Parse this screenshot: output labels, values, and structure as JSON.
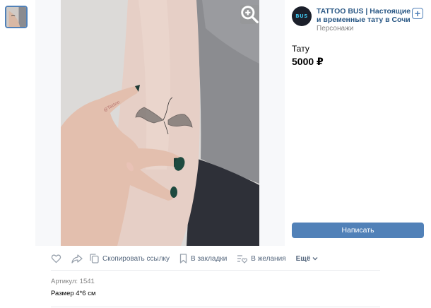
{
  "owner": {
    "name": "TATTOO BUS | Настоящие и временные тату в Сочи",
    "category": "Персонажи",
    "avatar_text": "BUS"
  },
  "product": {
    "title": "Тату",
    "price": "5000 ₽",
    "write_label": "Написать",
    "article": "Артикул: 1541",
    "size": "Размер 4*6 см"
  },
  "actions": {
    "copy_link": "Скопировать ссылку",
    "bookmarks": "В закладки",
    "wishlist": "В желания",
    "more": "Ещё"
  },
  "colors": {
    "accent": "#5181b8",
    "link": "#2a5885",
    "muted": "#828282"
  },
  "icons": [
    "heart-icon",
    "share-icon",
    "copy-icon",
    "bookmark-icon",
    "wishlist-icon",
    "chevron-down-icon",
    "zoom-icon",
    "plus-icon"
  ]
}
